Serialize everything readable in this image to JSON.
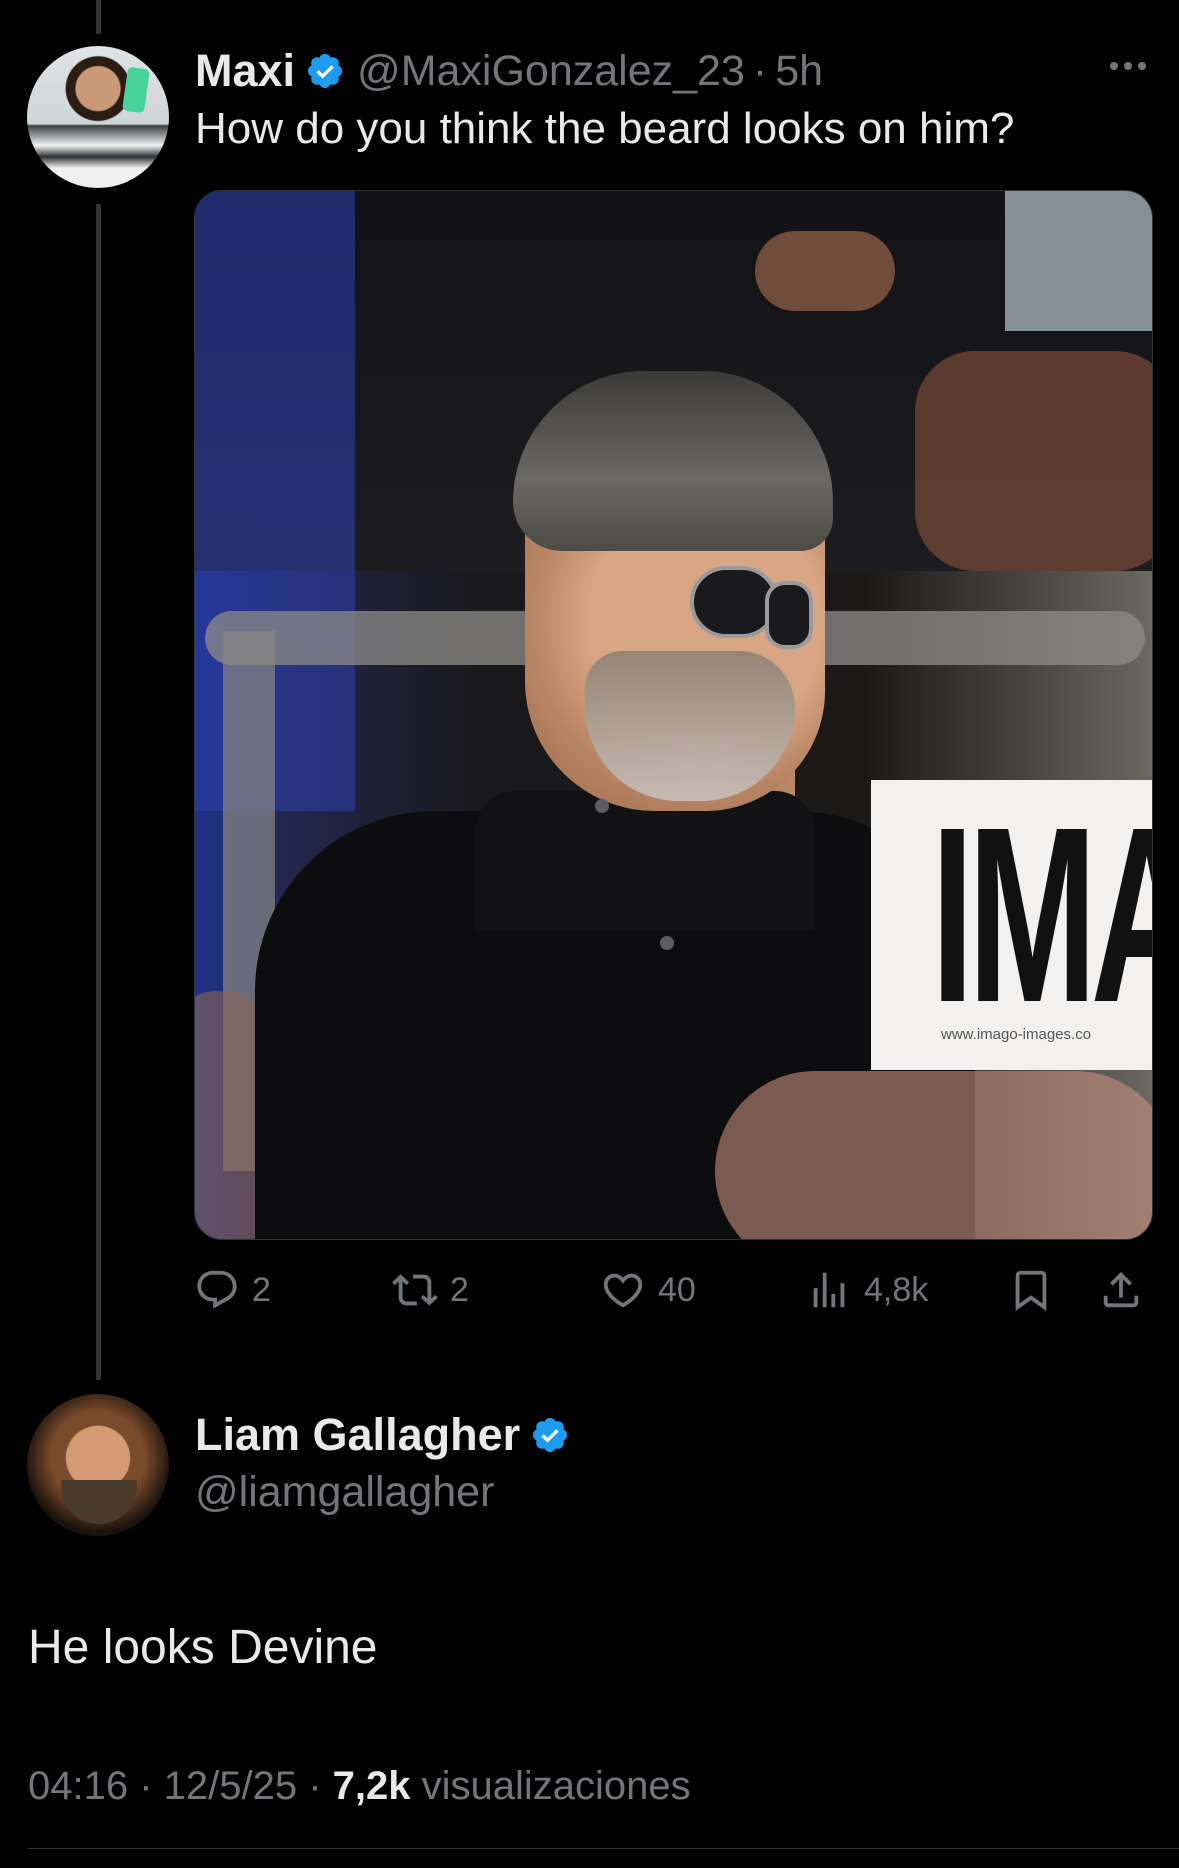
{
  "original_tweet": {
    "display_name": "Maxi",
    "handle": "@MaxiGonzalez_23",
    "separator": "·",
    "age": "5h",
    "text": "How do you think the beard looks on him?",
    "media": {
      "watermark_logo": "IMA",
      "watermark_url": "www.imago-images.co"
    },
    "actions": {
      "reply_count": "2",
      "retweet_count": "2",
      "like_count": "40",
      "views_count": "4,8k"
    }
  },
  "reply_tweet": {
    "display_name": "Liam Gallagher",
    "handle": "@liamgallagher",
    "text": "He looks Devine",
    "meta": {
      "time": "04:16",
      "sep1": " · ",
      "date": "12/5/25",
      "sep2": " · ",
      "views": "7,2k",
      "views_label": " visualizaciones"
    }
  },
  "colors": {
    "background": "#000000",
    "primary_text": "#e7e9ea",
    "secondary_text": "#71767b",
    "verified_blue": "#1d9bf0"
  },
  "icons": [
    "more-icon",
    "verified-icon",
    "reply-icon",
    "retweet-icon",
    "like-icon",
    "views-icon",
    "bookmark-icon",
    "share-icon"
  ]
}
